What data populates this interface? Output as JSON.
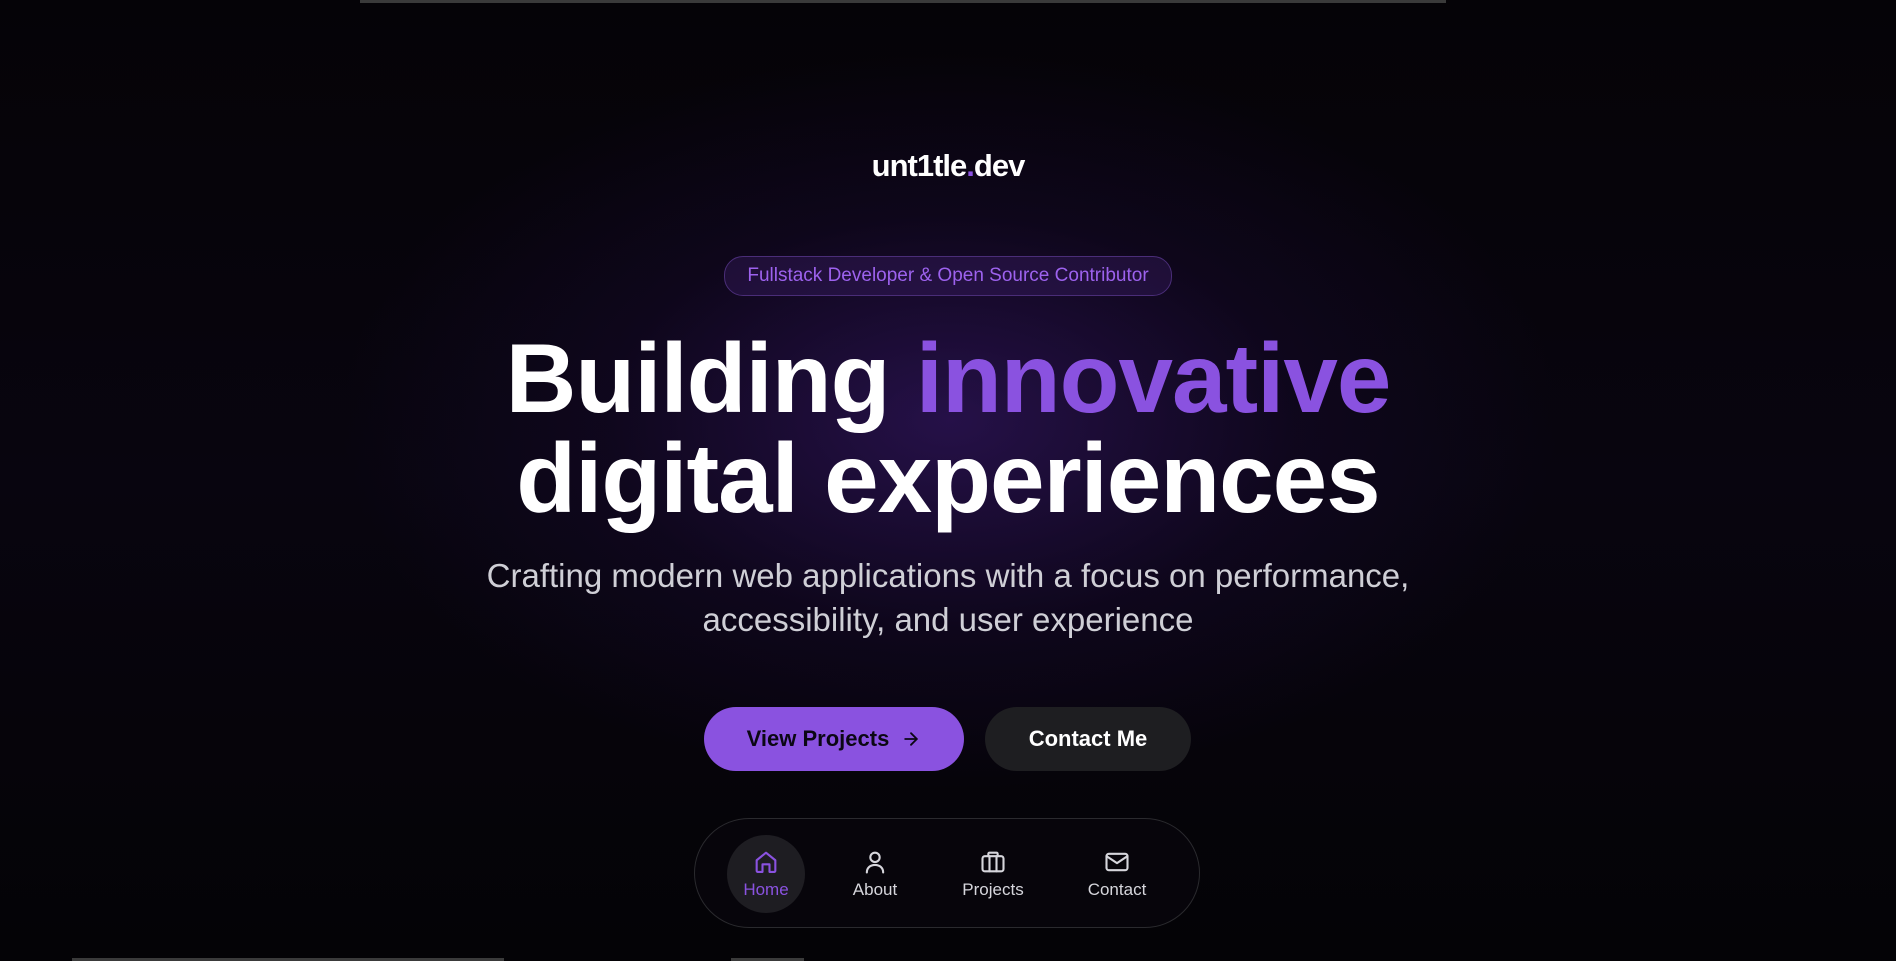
{
  "logo": {
    "name": "unt1tle",
    "dot": ".",
    "tld": "dev"
  },
  "hero": {
    "badge": "Fullstack Developer & Open Source Contributor",
    "headline_part1": "Building",
    "headline_accent": "innovative",
    "headline_line2": "digital experiences",
    "subtitle_line1": "Crafting modern web applications with a focus on performance,",
    "subtitle_line2": "accessibility, and user experience"
  },
  "buttons": {
    "primary_label": "View Projects",
    "primary_icon": "arrow-right-icon",
    "secondary_label": "Contact Me"
  },
  "dock": {
    "items": [
      {
        "label": "Home",
        "icon": "home-icon",
        "active": true
      },
      {
        "label": "About",
        "icon": "user-icon",
        "active": false
      },
      {
        "label": "Projects",
        "icon": "briefcase-icon",
        "active": false
      },
      {
        "label": "Contact",
        "icon": "mail-icon",
        "active": false
      }
    ]
  },
  "colors": {
    "accent": "#8a52e0",
    "background": "#000000",
    "secondary_button": "#1e1e21"
  }
}
